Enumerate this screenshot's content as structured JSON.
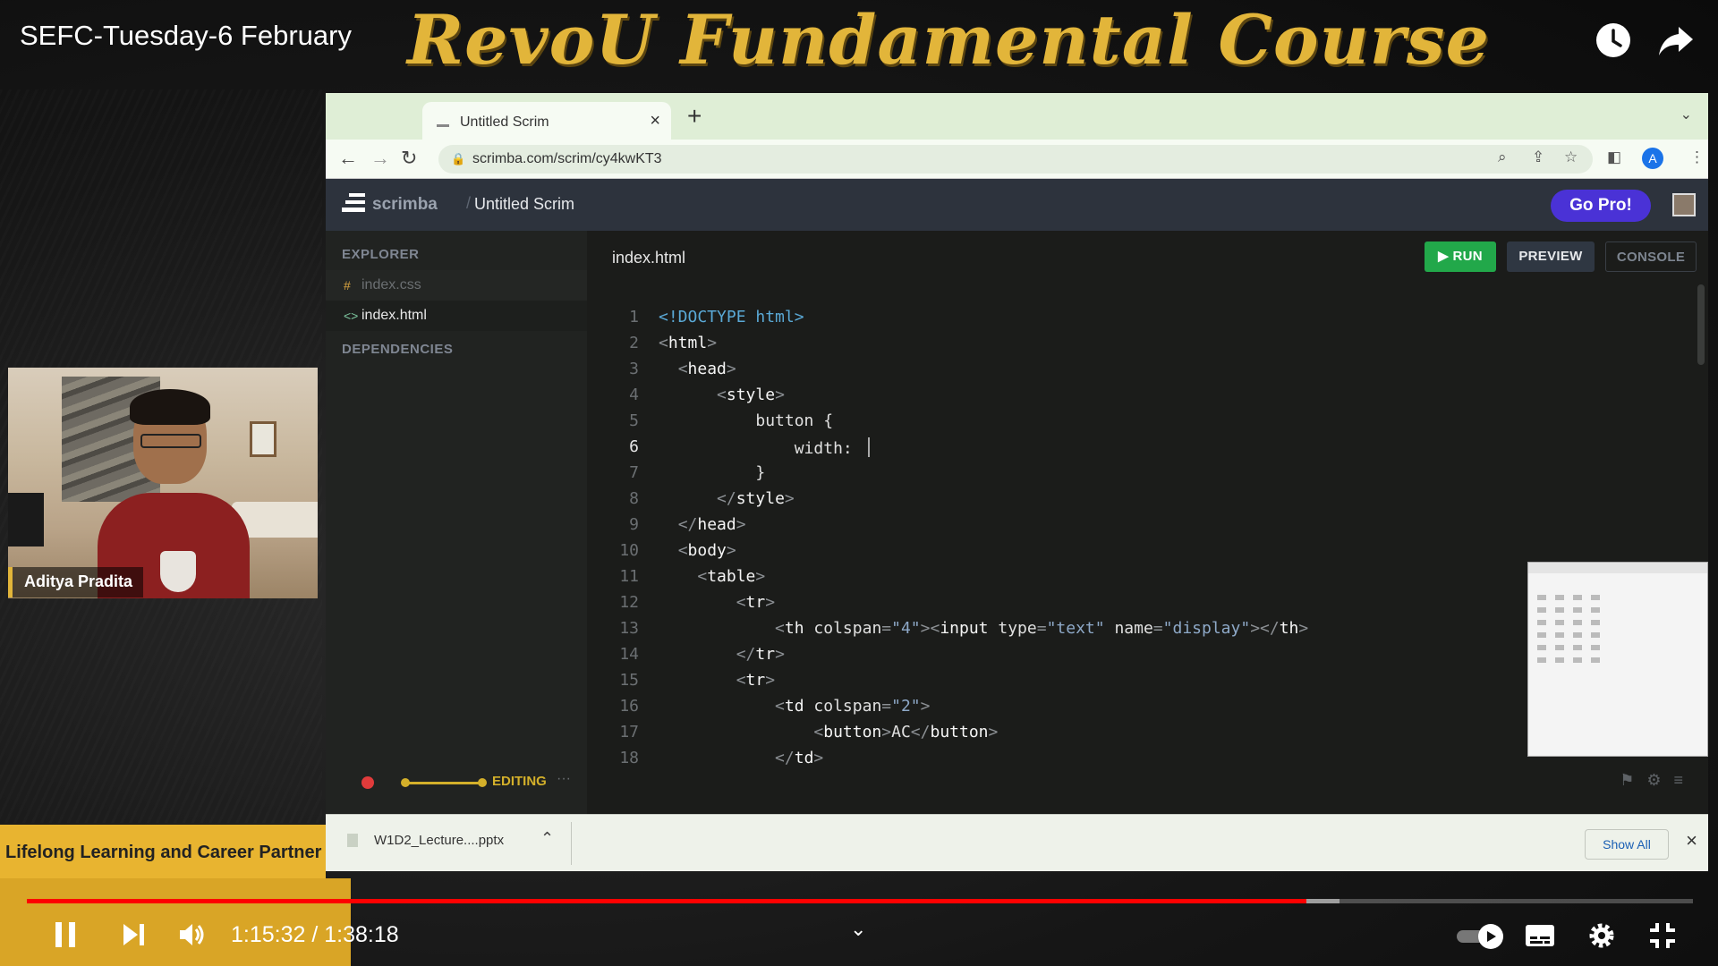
{
  "video": {
    "title": "SEFC-Tuesday-6 February",
    "banner": "RevoU Fundamental Course",
    "current_time": "1:15:32",
    "duration": "1:38:18",
    "time_display": "1:15:32 / 1:38:18",
    "progress_played_fraction": 0.768,
    "progress_buffered_fraction": 0.788
  },
  "browser": {
    "tab_title": "Untitled Scrim",
    "url": "scrimba.com/scrim/cy4kwKT3",
    "profile_initial": "A"
  },
  "scrimba": {
    "brand": "scrimba",
    "scrim_title": "Untitled Scrim",
    "go_pro_label": "Go Pro!",
    "explorer_label": "EXPLORER",
    "dependencies_label": "DEPENDENCIES",
    "files": [
      "index.css",
      "index.html"
    ],
    "active_file": "index.html",
    "run_label": "RUN",
    "preview_label": "PREVIEW",
    "console_label": "CONSOLE",
    "editing_label": "EDITING"
  },
  "code_lines": [
    {
      "n": "1",
      "text": "<!DOCTYPE html>"
    },
    {
      "n": "2",
      "text": "<html>"
    },
    {
      "n": "3",
      "text": "  <head>"
    },
    {
      "n": "4",
      "text": "      <style>"
    },
    {
      "n": "5",
      "text": "          button {"
    },
    {
      "n": "6",
      "text": "              width: "
    },
    {
      "n": "7",
      "text": "          }"
    },
    {
      "n": "8",
      "text": "      </style>"
    },
    {
      "n": "9",
      "text": "  </head>"
    },
    {
      "n": "10",
      "text": "  <body>"
    },
    {
      "n": "11",
      "text": "    <table>"
    },
    {
      "n": "12",
      "text": "        <tr>"
    },
    {
      "n": "13",
      "text": "            <th colspan=\"4\"><input type=\"text\" name=\"display\"></th>"
    },
    {
      "n": "14",
      "text": "        </tr>"
    },
    {
      "n": "15",
      "text": "        <tr>"
    },
    {
      "n": "16",
      "text": "            <td colspan=\"2\">"
    },
    {
      "n": "17",
      "text": "                <button>AC</button>"
    },
    {
      "n": "18",
      "text": "            </td>"
    }
  ],
  "current_line": "6",
  "download": {
    "filename": "W1D2_Lecture....pptx",
    "show_all_label": "Show All"
  },
  "presenter": {
    "name": "Aditya Pradita"
  },
  "lower_third": {
    "text": "Lifelong Learning and Career Partner"
  },
  "colors": {
    "accent_gold": "#e2b53a",
    "progress_red": "#ff0000",
    "run_green": "#22a84a",
    "gopro_purple": "#4a32d6"
  },
  "icons": {
    "top_right": [
      "watch-later-icon",
      "share-icon"
    ],
    "player": [
      "pause-icon",
      "next-icon",
      "volume-icon",
      "autoplay-toggle-icon",
      "subtitles-icon",
      "settings-icon",
      "exit-fullscreen-icon"
    ]
  }
}
